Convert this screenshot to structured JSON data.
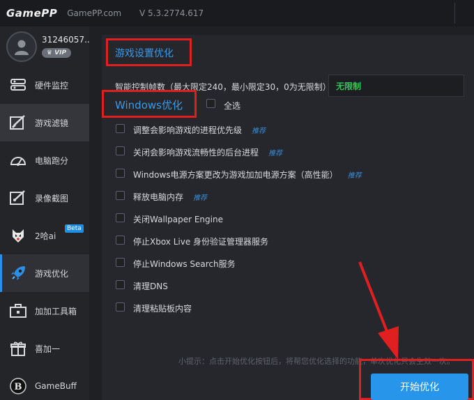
{
  "titlebar": {
    "logo": "GamePP",
    "site": "GamePP.com",
    "version": "V 5.3.2774.617"
  },
  "profile": {
    "user_id": "31246057...",
    "vip": "VIP"
  },
  "sidebar": {
    "items": [
      {
        "label": "硬件监控",
        "icon": "hardware-monitor-icon"
      },
      {
        "label": "游戏滤镜",
        "icon": "game-filter-icon"
      },
      {
        "label": "电脑跑分",
        "icon": "benchmark-gauge-icon"
      },
      {
        "label": "录像截图",
        "icon": "record-screenshot-icon"
      },
      {
        "label": "2哈ai",
        "icon": "husky-ai-icon",
        "badge": "Beta"
      },
      {
        "label": "游戏优化",
        "icon": "rocket-icon"
      },
      {
        "label": "加加工具箱",
        "icon": "toolbox-icon"
      },
      {
        "label": "喜加一",
        "icon": "gift-icon"
      },
      {
        "label": "GameBuff",
        "icon": "gamebuff-icon"
      }
    ]
  },
  "main": {
    "game_settings_title": "游戏设置优化",
    "fps_label": "智能控制帧数（最大限定240，最小限定30，0为无限制）",
    "fps_value": "无限制",
    "windows_title": "Windows优化",
    "select_all": "全选",
    "recommend": "推荐",
    "options": [
      {
        "label": "调整会影响游戏的进程优先级",
        "recommended": true,
        "checked": false
      },
      {
        "label": "关闭会影响游戏流畅性的后台进程",
        "recommended": true,
        "checked": false
      },
      {
        "label": "Windows电源方案更改为游戏加加电源方案（高性能）",
        "recommended": true,
        "checked": false
      },
      {
        "label": "释放电脑内存",
        "recommended": true,
        "checked": false
      },
      {
        "label": "关闭Wallpaper Engine",
        "recommended": false,
        "checked": false
      },
      {
        "label": "停止Xbox Live 身份验证管理器服务",
        "recommended": false,
        "checked": false
      },
      {
        "label": "停止Windows Search服务",
        "recommended": false,
        "checked": false
      },
      {
        "label": "清理DNS",
        "recommended": false,
        "checked": false
      },
      {
        "label": "清理粘贴板内容",
        "recommended": false,
        "checked": false
      }
    ],
    "hint": "小提示：点击开始优化按钮后，将帮您优化选择的功能，单次优化只会生效一次。",
    "start_button": "开始优化"
  },
  "colors": {
    "accent": "#2795e9",
    "highlight_box": "#e02020",
    "fps_value": "#36c45a"
  }
}
